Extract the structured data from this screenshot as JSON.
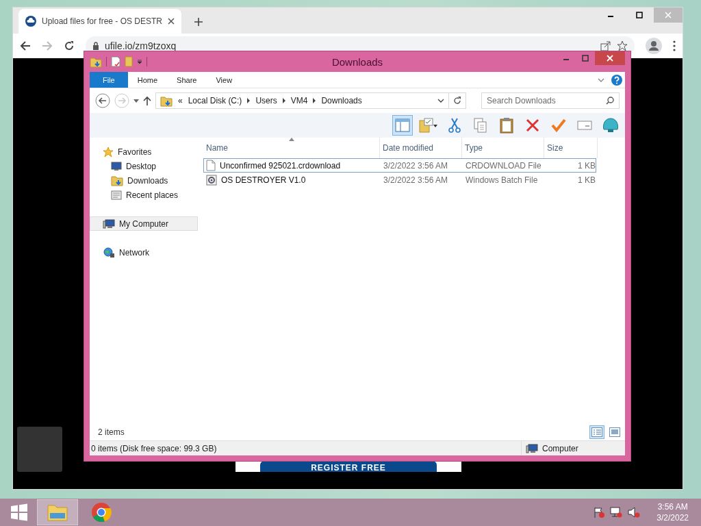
{
  "browser": {
    "tabs": [
      {
        "title": "Upload files for free - OS DESTR",
        "selected": true
      }
    ],
    "url": "ufile.io/zm9tzoxq",
    "page_button": "REGISTER FREE"
  },
  "explorer": {
    "title": "Downloads",
    "ribbon_tabs": [
      {
        "label": "File",
        "kind": "file"
      },
      {
        "label": "Home",
        "kind": "tab"
      },
      {
        "label": "Share",
        "kind": "tab"
      },
      {
        "label": "View",
        "kind": "tab"
      }
    ],
    "address": {
      "overflow": "«",
      "crumbs": [
        "Local Disk (C:)",
        "Users",
        "VM4",
        "Downloads"
      ]
    },
    "search": {
      "placeholder": "Search Downloads"
    },
    "nav": [
      {
        "label": "Favorites",
        "kind": "star",
        "selected": false,
        "children": [
          {
            "label": "Desktop",
            "kind": "desktop",
            "selected": false
          },
          {
            "label": "Downloads",
            "kind": "downloads",
            "selected": false
          },
          {
            "label": "Recent places",
            "kind": "recent",
            "selected": false
          }
        ]
      },
      {
        "label": "My Computer",
        "kind": "computer",
        "selected": true
      },
      {
        "label": "Network",
        "kind": "network",
        "selected": false
      }
    ],
    "columns": [
      "Name",
      "Date modified",
      "Type",
      "Size"
    ],
    "rows": [
      {
        "name": "Unconfirmed 925021.crdownload",
        "date": "3/2/2022 3:56 AM",
        "type": "CRDOWNLOAD File",
        "size": "1 KB",
        "kind": "file",
        "selected": true
      },
      {
        "name": "OS DESTROYER V1.0",
        "date": "3/2/2022 3:56 AM",
        "type": "Windows Batch File",
        "size": "1 KB",
        "kind": "batch",
        "selected": false
      }
    ],
    "item_count": "2 items",
    "views": [
      {
        "kind": "details",
        "selected": true
      },
      {
        "kind": "preview",
        "selected": false
      }
    ],
    "status": "0 items (Disk free space: 99.3 GB)",
    "status_location": "Computer"
  },
  "taskbar": {
    "apps": [
      {
        "kind": "explorer",
        "selected": true
      },
      {
        "kind": "chrome",
        "selected": false
      }
    ],
    "time": "3:56 AM",
    "date": "3/2/2022"
  }
}
